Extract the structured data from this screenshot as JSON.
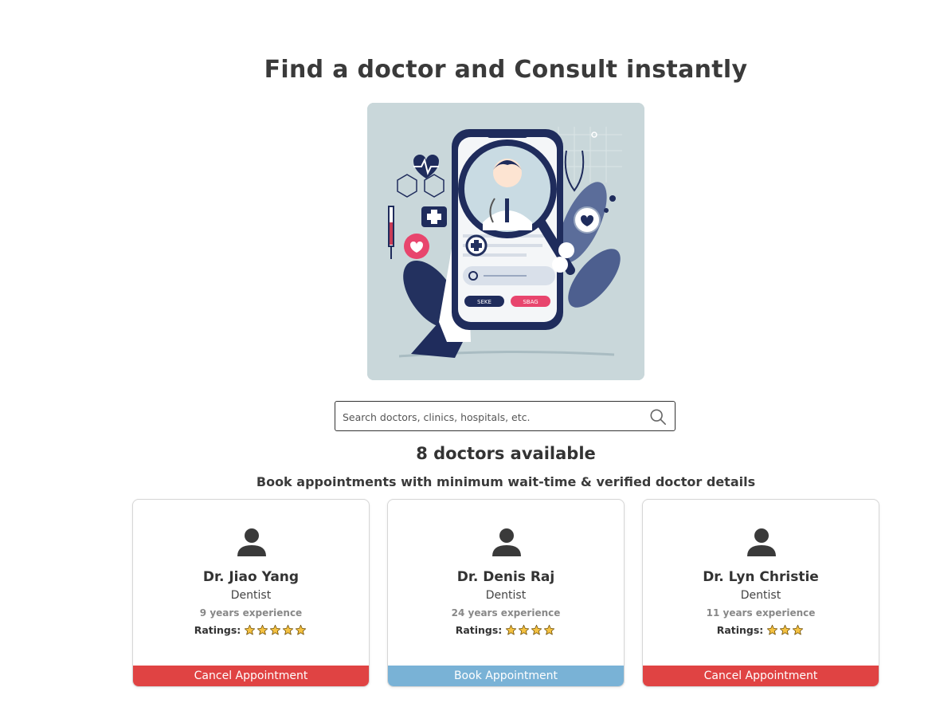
{
  "header": {
    "title": "Find a doctor and Consult instantly"
  },
  "hero": {
    "phone_buttons": [
      "SEKE",
      "SBAG"
    ]
  },
  "search": {
    "placeholder": "Search doctors, clinics, hospitals, etc.",
    "value": ""
  },
  "summary": {
    "count_text": "8 doctors available",
    "subtitle": "Book appointments with minimum wait-time & verified doctor details"
  },
  "ratings_label": "Ratings:",
  "doctors": [
    {
      "name": "Dr. Jiao Yang",
      "speciality": "Dentist",
      "experience": "9 years experience",
      "rating": 5,
      "action": "Cancel Appointment",
      "action_color": "#e04343"
    },
    {
      "name": "Dr. Denis Raj",
      "speciality": "Dentist",
      "experience": "24 years experience",
      "rating": 4,
      "action": "Book Appointment",
      "action_color": "#79b2d6"
    },
    {
      "name": "Dr. Lyn Christie",
      "speciality": "Dentist",
      "experience": "11 years experience",
      "rating": 3,
      "action": "Cancel Appointment",
      "action_color": "#e04343"
    }
  ],
  "colors": {
    "star": "#f5c242",
    "cancel": "#e04343",
    "book": "#79b2d6",
    "navy": "#1f2c5c",
    "pink": "#e8456d"
  }
}
